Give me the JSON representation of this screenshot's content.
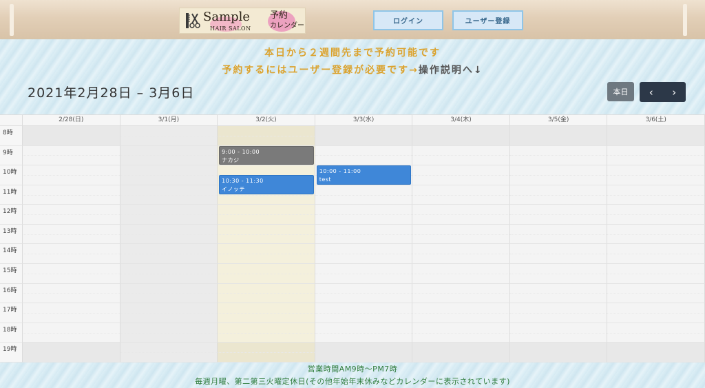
{
  "header": {
    "logo": {
      "sample": "Sample",
      "hair_salon": "HAIR SALON",
      "yoyaku": "予約",
      "calendar": "カレンダー"
    },
    "login_label": "ログイン",
    "register_label": "ユーザー登録"
  },
  "notice": {
    "line1": "本日から２週間先まで予約可能です",
    "line2": "予約するにはユーザー登録が必要です→",
    "link": "操作説明へ↓"
  },
  "calendar": {
    "title": "2021年2月28日 – 3月6日",
    "today_label": "本日",
    "prev_label": "‹",
    "next_label": "›",
    "days": [
      "2/28(日)",
      "3/1(月)",
      "3/2(火)",
      "3/3(水)",
      "3/4(木)",
      "3/5(金)",
      "3/6(土)"
    ],
    "hours": [
      "8時",
      "9時",
      "10時",
      "11時",
      "12時",
      "13時",
      "14時",
      "15時",
      "16時",
      "17時",
      "18時",
      "19時"
    ],
    "events": [
      {
        "day_index": 2,
        "start": "9:00",
        "end": "10:00",
        "time": "9:00 - 10:00",
        "title": "ナカジ",
        "color": "gray"
      },
      {
        "day_index": 2,
        "start": "10:30",
        "end": "11:30",
        "time": "10:30 - 11:30",
        "title": "イノッチ",
        "color": "blue"
      },
      {
        "day_index": 3,
        "start": "10:00",
        "end": "11:00",
        "time": "10:00 - 11:00",
        "title": "test",
        "color": "blue"
      }
    ]
  },
  "footer": {
    "hours_text": "営業時間AM9時〜PM7時",
    "holiday_text": "毎週月曜、第二第三火曜定休日(その他年始年末休みなどカレンダーに表示されています)"
  },
  "colors": {
    "accent_gold": "#dba32f",
    "footer_green": "#2f7c3b",
    "event_blue": "#3f87d8",
    "event_gray": "#7a7a7a",
    "nav_dark": "#2c3848"
  }
}
